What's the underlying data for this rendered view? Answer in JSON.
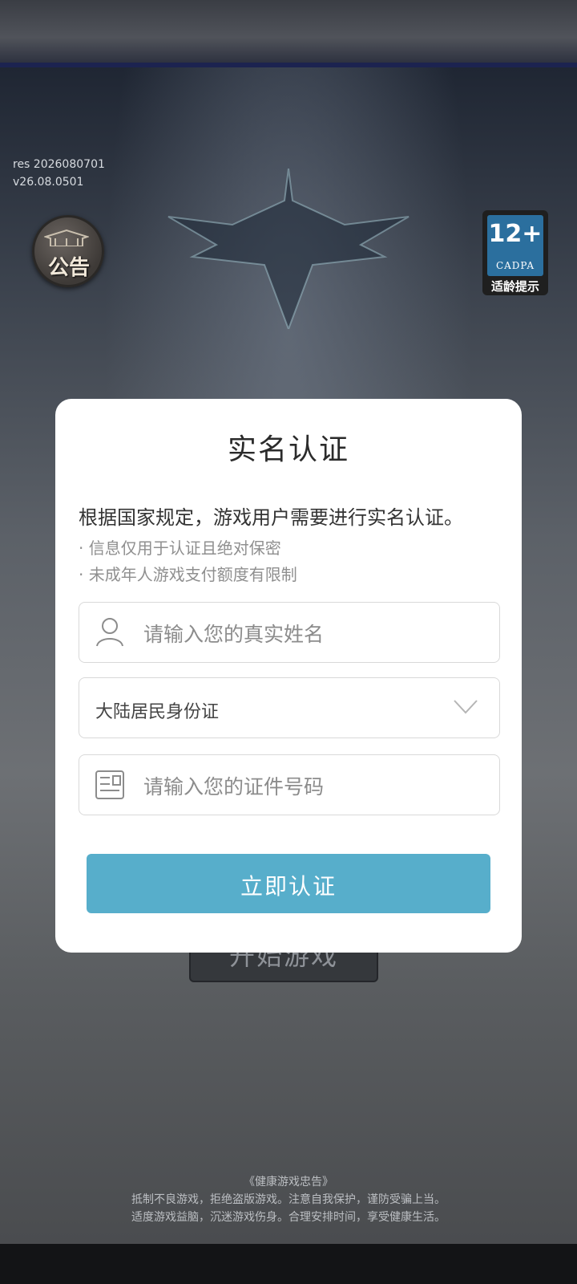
{
  "version": {
    "res": "res 2026080701",
    "app": "v26.08.0501"
  },
  "notice_button": {
    "label": "公告"
  },
  "age_rating": {
    "number": "12+",
    "org": "CADPA",
    "tip": "适龄提示"
  },
  "start_button": {
    "label": "开始游戏"
  },
  "health_notice": {
    "title": "《健康游戏忠告》",
    "line1": "抵制不良游戏，拒绝盗版游戏。注意自我保护，谨防受骗上当。",
    "line2": "适度游戏益脑，沉迷游戏伤身。合理安排时间，享受健康生活。"
  },
  "dialog": {
    "title": "实名认证",
    "description": "根据国家规定，游戏用户需要进行实名认证。",
    "notes": [
      "· 信息仅用于认证且绝对保密",
      "· 未成年人游戏支付额度有限制"
    ],
    "name_field": {
      "placeholder": "请输入您的真实姓名",
      "icon": "person-icon"
    },
    "id_type_select": {
      "selected": "大陆居民身份证",
      "icon": "chevron-down-icon"
    },
    "id_number_field": {
      "placeholder": "请输入您的证件号码",
      "icon": "id-card-icon"
    },
    "submit_label": "立即认证",
    "accent_color": "#57aecb"
  }
}
